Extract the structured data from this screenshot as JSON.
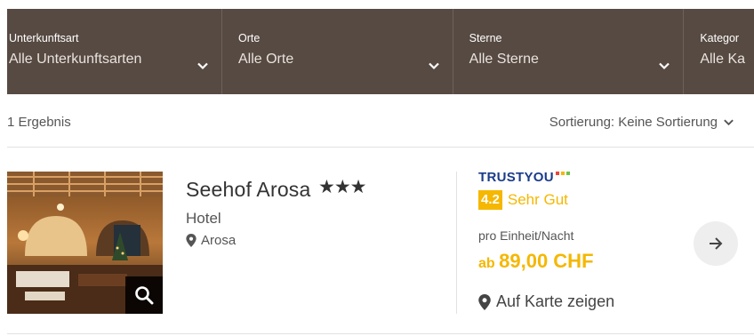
{
  "filters": [
    {
      "label": "Unterkunftsart",
      "value": "Alle Unterkunftsarten"
    },
    {
      "label": "Orte",
      "value": "Alle Orte"
    },
    {
      "label": "Sterne",
      "value": "Alle Sterne"
    },
    {
      "label": "Kategor",
      "value": "Alle Ka"
    }
  ],
  "results": {
    "count_text": "1 Ergebnis",
    "sort_text": "Sortierung: Keine Sortierung"
  },
  "hotel": {
    "name": "Seehof Arosa",
    "stars_text": "★★★",
    "stars": 3,
    "type": "Hotel",
    "location": "Arosa"
  },
  "rating": {
    "provider": "TRUSTYOU",
    "score": "4.2",
    "label": "Sehr Gut"
  },
  "pricing": {
    "per_unit": "pro Einheit/Nacht",
    "prefix": "ab",
    "amount": "89,00 CHF"
  },
  "map_link": "Auf Karte zeigen",
  "colors": {
    "filter_bg": "#574a42",
    "accent": "#f5b700",
    "trustyou_blue": "#1a3c8a"
  },
  "icons": {
    "filter_chevron": "chevron-down-icon",
    "sort_chevron": "chevron-down-icon",
    "zoom": "search-icon",
    "location": "map-marker-icon",
    "next": "arrow-right-icon"
  }
}
